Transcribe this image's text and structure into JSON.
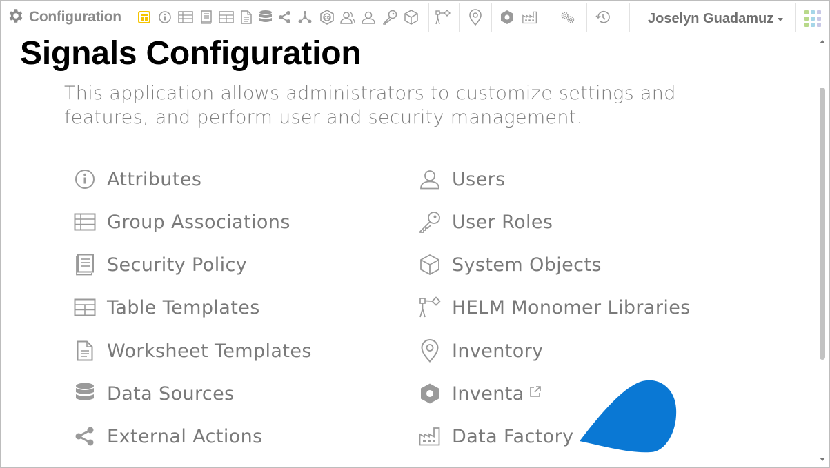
{
  "app": {
    "name": "Configuration",
    "user_name": "Joselyn Guadamuz"
  },
  "toolbar": {
    "icons": [
      "settings-icon",
      "dashboard-icon",
      "info-icon",
      "table-icon",
      "policy-book-icon",
      "table-template-icon",
      "document-icon",
      "database-icon",
      "share-icon",
      "network-icon",
      "cd-badge-icon",
      "users-icon",
      "user-icon",
      "key-icon",
      "cube-icon",
      "helm-icon",
      "location-pin-icon",
      "inventa-icon",
      "factory-icon",
      "gears-icon",
      "history-icon"
    ],
    "accent_color": "#f5c400"
  },
  "page": {
    "title": "Signals Configuration",
    "description": "This application allows administrators to customize settings and features, and perform user and security management."
  },
  "menu": {
    "left": [
      {
        "label": "Attributes",
        "icon": "info-circle-icon"
      },
      {
        "label": "Group Associations",
        "icon": "grid-table-icon"
      },
      {
        "label": "Security Policy",
        "icon": "policy-book-icon"
      },
      {
        "label": "Table Templates",
        "icon": "table-template-icon"
      },
      {
        "label": "Worksheet Templates",
        "icon": "document-icon"
      },
      {
        "label": "Data Sources",
        "icon": "database-icon"
      },
      {
        "label": "External Actions",
        "icon": "share-icon"
      }
    ],
    "right": [
      {
        "label": "Users",
        "icon": "user-icon"
      },
      {
        "label": "User Roles",
        "icon": "key-icon"
      },
      {
        "label": "System Objects",
        "icon": "cube-icon"
      },
      {
        "label": "HELM Monomer Libraries",
        "icon": "helm-icon"
      },
      {
        "label": "Inventory",
        "icon": "location-pin-icon"
      },
      {
        "label": "Inventa",
        "icon": "inventa-icon",
        "external": true
      },
      {
        "label": "Data Factory",
        "icon": "factory-icon"
      }
    ]
  },
  "colors": {
    "icon_gray": "#9a9a9a",
    "text_gray": "#7a7a7a",
    "title_black": "#000000",
    "blob_blue": "#0a78d4",
    "apps_grid_colors": [
      "#b8d98a",
      "#a6d6e8",
      "#c8c8e6",
      "#b8d98a",
      "#a6d6e8",
      "#c8c8e6",
      "#b8d98a",
      "#a6d6e8",
      "#c8c8e6"
    ]
  }
}
